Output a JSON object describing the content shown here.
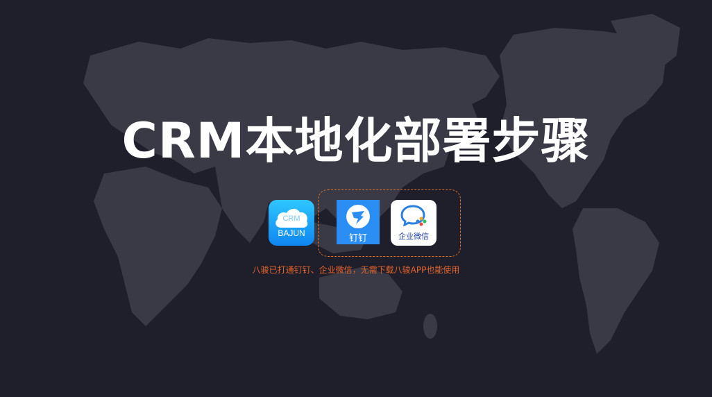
{
  "title": "CRM本地化部署步骤",
  "apps": {
    "crm": {
      "icon": "cloud-icon",
      "badge": "CRM",
      "label": "BAJUN",
      "color": "#1a9cf6"
    },
    "dingtalk": {
      "icon": "dingtalk-bird-icon",
      "label": "钉钉",
      "color": "#2b8ef5"
    },
    "wecom": {
      "icon": "wecom-chat-icon",
      "label": "企业微信",
      "color": "#ffffff"
    }
  },
  "note": "八骏已打通钉钉、企业微信，无需下载八骏APP也能使用",
  "colors": {
    "background": "#1f1f2b",
    "map": "#3a3a46",
    "accent": "#e2701f",
    "note": "#e6642a"
  }
}
